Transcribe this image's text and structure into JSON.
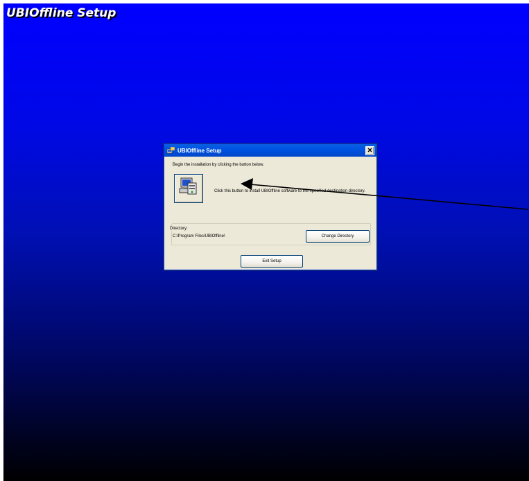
{
  "banner": {
    "title": "UBIOffline Setup"
  },
  "dialog": {
    "title": "UBIOffline Setup",
    "instruction": "Begin the installation by clicking the button below.",
    "install_description": "Click this button to install UBIOffline software to the specified destination directory.",
    "directory_label": "Directory:",
    "directory_path": "C:\\Program Files\\UBIOffline\\",
    "change_directory_label": "Change Directory",
    "exit_setup_label": "Exit Setup"
  },
  "icons": {
    "title": "setup-icon",
    "close": "close-icon",
    "install": "computer-install-icon",
    "pointer": "arrow-pointer"
  },
  "colors": {
    "background_top": "#0000ff",
    "background_bottom": "#000000",
    "titlebar": "#0054e3",
    "dialog_face": "#ece9d8"
  }
}
